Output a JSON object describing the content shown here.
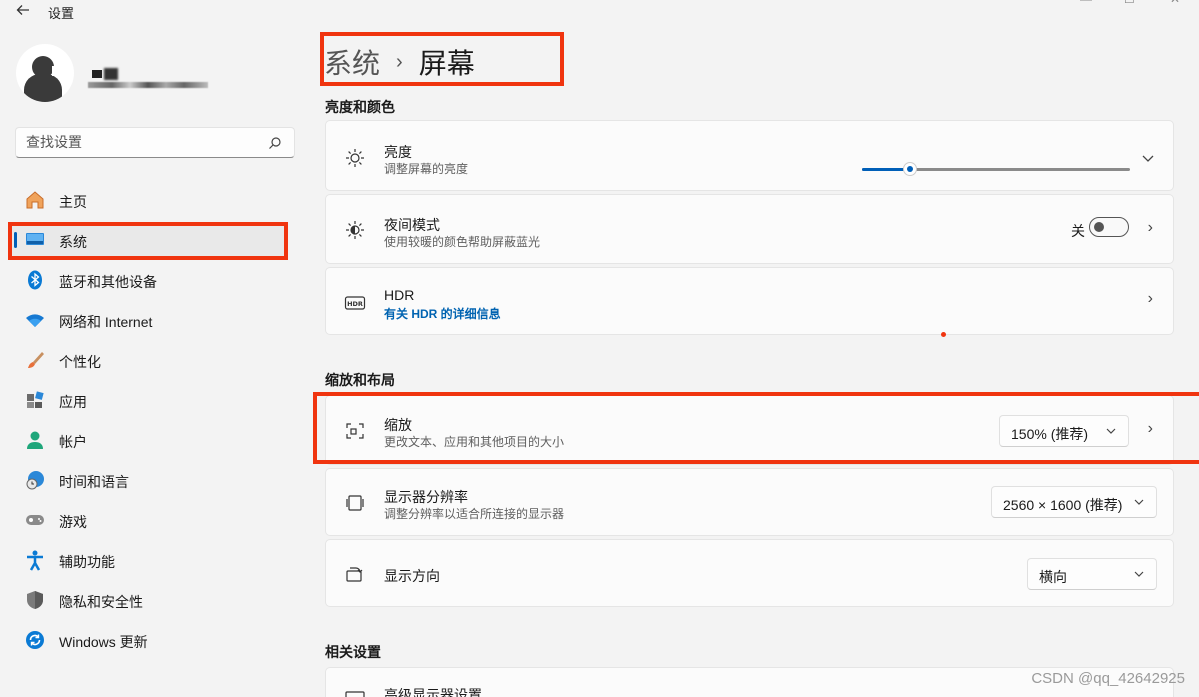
{
  "titlebar": {
    "back_icon": "arrow-left-icon",
    "title": "设置",
    "minimize": "—",
    "maximize": "☐",
    "close": "✕"
  },
  "profile": {
    "avatar_icon": "user-avatar-icon"
  },
  "search": {
    "placeholder": "查找设置",
    "icon": "search-icon"
  },
  "sidebar": {
    "items": [
      {
        "label": "主页",
        "icon": "home-icon"
      },
      {
        "label": "系统",
        "icon": "system-display-icon",
        "active": true
      },
      {
        "label": "蓝牙和其他设备",
        "icon": "bluetooth-icon"
      },
      {
        "label": "网络和 Internet",
        "icon": "wifi-icon"
      },
      {
        "label": "个性化",
        "icon": "brush-icon"
      },
      {
        "label": "应用",
        "icon": "apps-icon"
      },
      {
        "label": "帐户",
        "icon": "account-icon"
      },
      {
        "label": "时间和语言",
        "icon": "globe-clock-icon"
      },
      {
        "label": "游戏",
        "icon": "gamepad-icon"
      },
      {
        "label": "辅助功能",
        "icon": "accessibility-icon"
      },
      {
        "label": "隐私和安全性",
        "icon": "shield-icon"
      },
      {
        "label": "Windows 更新",
        "icon": "update-icon"
      }
    ]
  },
  "breadcrumb": {
    "parent": "系统",
    "separator": "›",
    "current": "屏幕"
  },
  "sections": {
    "brightness_color": "亮度和颜色",
    "scale_layout": "缩放和布局",
    "related": "相关设置"
  },
  "brightness": {
    "title": "亮度",
    "subtitle": "调整屏幕的亮度",
    "level_percent": 18
  },
  "night_mode": {
    "title": "夜间模式",
    "subtitle": "使用较暖的颜色帮助屏蔽蓝光",
    "state_label": "关"
  },
  "hdr": {
    "title": "HDR",
    "link": "有关 HDR 的详细信息"
  },
  "scale": {
    "title": "缩放",
    "subtitle": "更改文本、应用和其他项目的大小",
    "value": "150% (推荐)"
  },
  "resolution": {
    "title": "显示器分辨率",
    "subtitle": "调整分辨率以适合所连接的显示器",
    "value": "2560 × 1600 (推荐)"
  },
  "orientation": {
    "title": "显示方向",
    "value": "横向"
  },
  "advanced": {
    "title": "高级显示器设置"
  },
  "watermark": "CSDN @qq_42642925",
  "colors": {
    "accent": "#005fb8",
    "annotation_red": "#f0340f"
  }
}
